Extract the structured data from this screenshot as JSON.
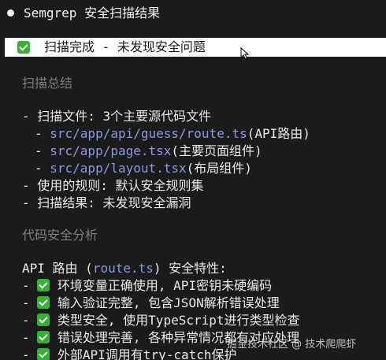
{
  "title": "Semgrep 安全扫描结果",
  "status": {
    "check_icon": "check-mark-icon",
    "text": "扫描完成 - 未发现安全问题"
  },
  "summary": {
    "heading": "扫描总结",
    "files_label": "- 扫描文件: 3个主要源代码文件",
    "files": [
      {
        "path": "src/app/api/guess/route.ts",
        "desc": "(API路由)"
      },
      {
        "path": "src/app/page.tsx",
        "desc": "(主要页面组件)"
      },
      {
        "path": "src/app/layout.tsx",
        "desc": "(布局组件)"
      }
    ],
    "rules_line": "- 使用的规则: 默认安全规则集",
    "result_line": "- 扫描结果: 未发现安全漏洞"
  },
  "analysis": {
    "heading": "代码安全分析",
    "api_intro_prefix": "API 路由 (",
    "api_intro_code": "route.ts",
    "api_intro_suffix": ") 安全特性:",
    "items": [
      "环境变量正确使用, API密钥未硬编码",
      "输入验证完整, 包含JSON解析错误处理",
      "类型安全, 使用TypeScript进行类型检查",
      "错误处理完善, 各种异常情况都有对应处理",
      "外部API调用有try-catch保护"
    ]
  },
  "watermark": "掘金技术社区 @ 技术爬爬虾",
  "colors": {
    "background": "#1b1b1b",
    "check_green": "#34b233",
    "path_blue": "#8f96df",
    "heading_gray": "#7d7d7d"
  }
}
